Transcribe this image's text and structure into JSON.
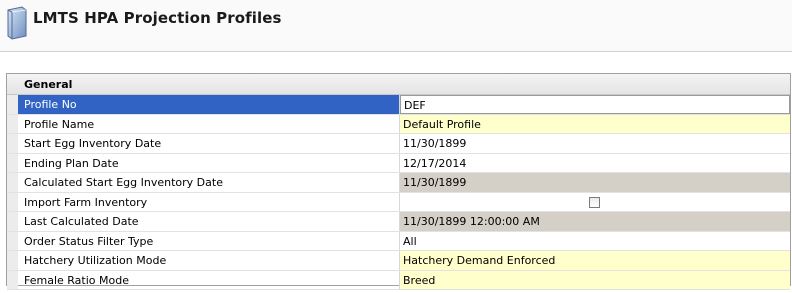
{
  "window": {
    "title": "LMTS HPA Projection Profiles",
    "icon": "document-icon"
  },
  "group": {
    "label": "General"
  },
  "rows": [
    {
      "name": "Profile No",
      "value": "DEF"
    },
    {
      "name": "Profile Name",
      "value": "Default Profile"
    },
    {
      "name": "Start Egg Inventory Date",
      "value": "11/30/1899"
    },
    {
      "name": "Ending Plan Date",
      "value": "12/17/2014"
    },
    {
      "name": "Calculated Start Egg Inventory Date",
      "value": "11/30/1899"
    },
    {
      "name": "Import Farm Inventory",
      "value": "",
      "checked": false
    },
    {
      "name": "Last Calculated Date",
      "value": "11/30/1899 12:00:00 AM"
    },
    {
      "name": "Order Status Filter Type",
      "value": "All"
    },
    {
      "name": "Hatchery Utilization Mode",
      "value": "Hatchery Demand Enforced"
    },
    {
      "name": "Female Ratio Mode",
      "value": "Breed"
    }
  ],
  "colors": {
    "selection": "#3163c5",
    "editable_highlight": "#ffffcc",
    "readonly": "#d4d0c8"
  }
}
